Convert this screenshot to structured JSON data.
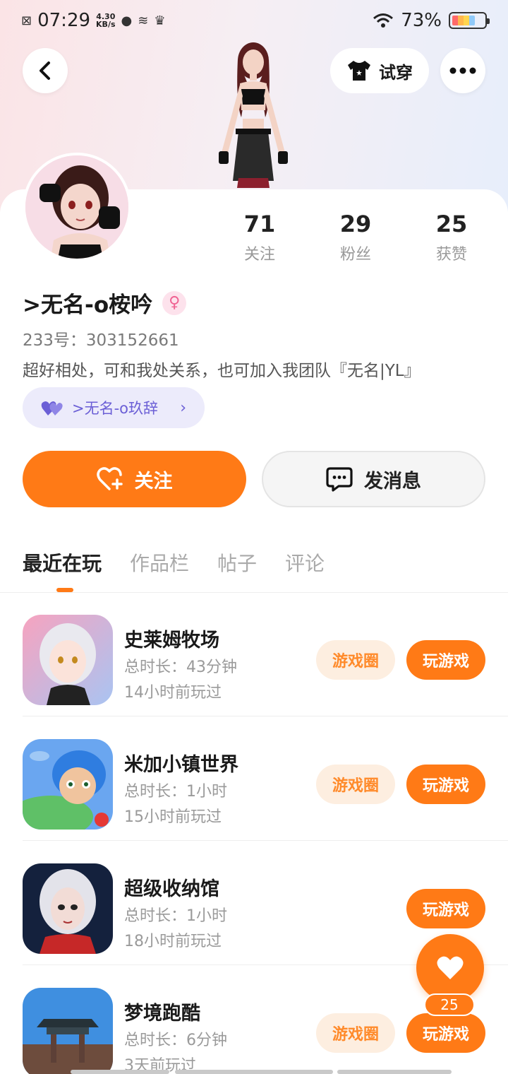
{
  "status_bar": {
    "time": "07:29",
    "net_speed_value": "4.30",
    "net_speed_unit": "KB/s",
    "battery": "73%"
  },
  "header": {
    "try_on_label": "试穿"
  },
  "profile": {
    "stats": [
      {
        "value": "71",
        "label": "关注"
      },
      {
        "value": "29",
        "label": "粉丝"
      },
      {
        "value": "25",
        "label": "获赞"
      }
    ],
    "username": ">无名-o桉吟",
    "uid": "233号：303152661",
    "bio": "超好相处，可和我处关系，也可加入我团队『无名|YL』",
    "team_chip": ">无名-o玖辞"
  },
  "actions": {
    "follow_label": "关注",
    "message_label": "发消息"
  },
  "tabs": [
    {
      "label": "最近在玩",
      "active": true
    },
    {
      "label": "作品栏",
      "active": false
    },
    {
      "label": "帖子",
      "active": false
    },
    {
      "label": "评论",
      "active": false
    }
  ],
  "games": [
    {
      "name": "史莱姆牧场",
      "duration": "总时长：43分钟",
      "last_played": "14小时前玩过",
      "circle_label": "游戏圈",
      "play_label": "玩游戏"
    },
    {
      "name": "米加小镇世界",
      "duration": "总时长：1小时",
      "last_played": "15小时前玩过",
      "circle_label": "游戏圈",
      "play_label": "玩游戏"
    },
    {
      "name": "超级收纳馆",
      "duration": "总时长：1小时",
      "last_played": "18小时前玩过",
      "circle_label": "",
      "play_label": "玩游戏"
    },
    {
      "name": "梦境跑酷",
      "duration": "总时长：6分钟",
      "last_played": "3天前玩过",
      "circle_label": "游戏圈",
      "play_label": "玩游戏"
    }
  ],
  "like_fab": {
    "count": "25"
  },
  "colors": {
    "accent": "#ff7a16",
    "accent_soft": "#fdeee0",
    "team_chip": "#ecebfb",
    "team_text": "#6b5fd6"
  }
}
